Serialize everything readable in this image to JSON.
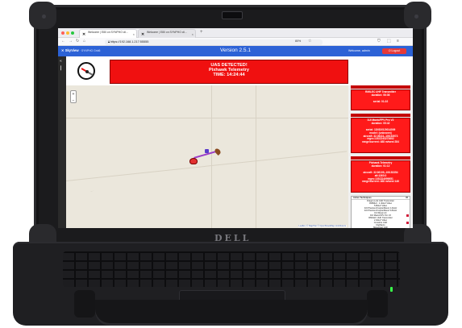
{
  "browser": {
    "tabs": [
      {
        "label": "Welcome | E80 on SYNPHO cli..."
      },
      {
        "label": "Welcome | E80 on SYNPHO cli..."
      }
    ],
    "url": "https://192.168.1.217:55555",
    "zoom": "80%"
  },
  "app": {
    "logo": "SkyView",
    "logo_sub": "· SYNPHO Grid6",
    "version": "Version 2.5.1",
    "welcome": "Welcome, admin",
    "logout_label": "Logout"
  },
  "alert": {
    "line1": "UAS DETECTED!",
    "line2": "Pixhawk Telemetry",
    "line3": "TIME: 14:24:44"
  },
  "map": {
    "zoom_in": "+",
    "zoom_out": "−",
    "attribution": "Leaflet | © MapTiler © OpenStreetMap contributors"
  },
  "detections": [
    {
      "lines": [
        "RMILEC UHF Transmitter",
        "duration: 06:08",
        "",
        "serial: 01-02"
      ]
    },
    {
      "lines": [
        "DJI Mavic/FPV Pro V2",
        "duration: 05:42",
        "",
        "serial: 1D0DX5J0014009",
        "model: (unknown)",
        "aircraft: 32.06111,-106.53973",
        "mgrs:13SCD43273602",
        "range/current: 488 m/west 284"
      ]
    },
    {
      "lines": [
        "Pixhawk Telemetry",
        "duration: 01:12",
        "",
        "aircraft: 32.06109,-106.53354",
        "alt:1360.0",
        "mgrs:13SCD4999651",
        "range/current: 468 m/west 146"
      ]
    }
  ],
  "techniques": {
    "header": "Active Techniques",
    "header_right": "ID",
    "rows": [
      "Dragon-Link UHF Transmitter",
      "930MHz - 1.4GHz Video",
      "5.8GHz Video",
      "DJI Phantom/Inspire/Mavic 2.4GHz",
      "DJI Phantom/Inspire/Mavic 5.8GHz",
      "DJI Mavic Air",
      "DJI Mavic/FPV Pro V2",
      "RMILEC UHF Transmitter",
      "2.4GHz Video",
      "Crossfire UHF",
      "DigiNavio",
      "Mavecleat UHF",
      "Pixhawk Telemetry"
    ]
  },
  "laptop": {
    "brand": "DELL"
  },
  "colors": {
    "alert_red": "#f01010",
    "app_blue": "#2c62d6",
    "logout_red": "#e63939",
    "track_purple": "#9b3ec7"
  }
}
